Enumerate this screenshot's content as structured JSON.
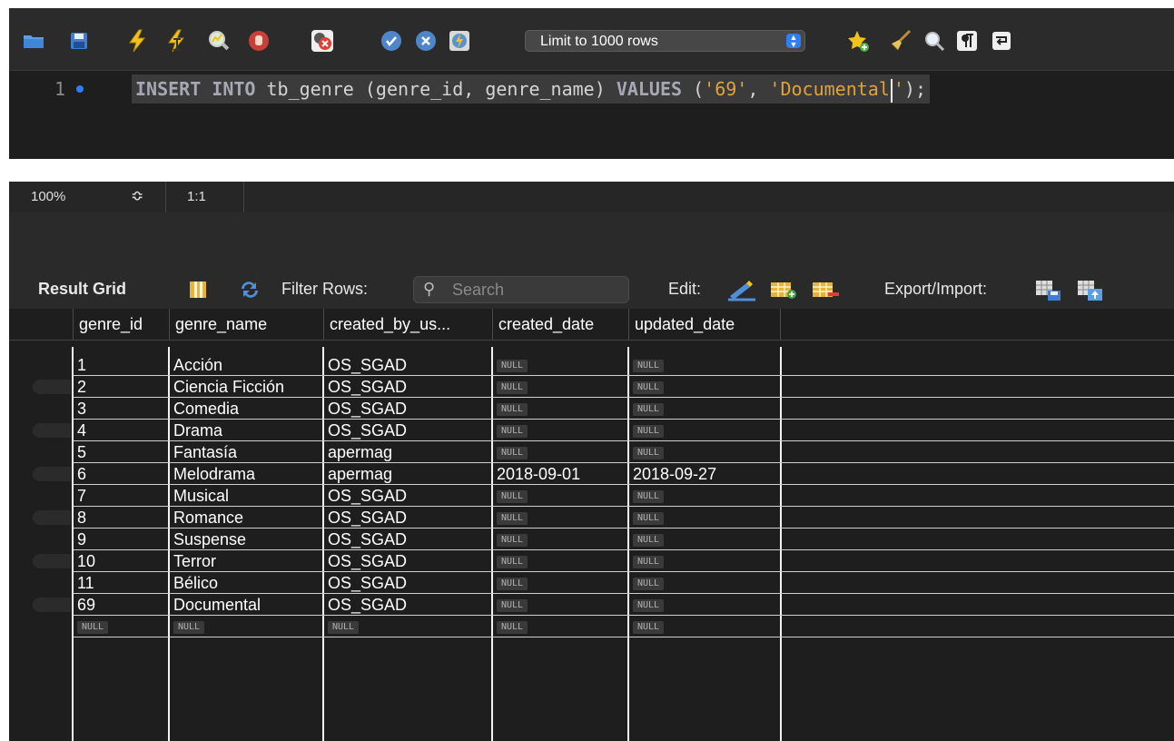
{
  "toolbar": {
    "limit_select_value": "Limit to 1000 rows",
    "icons": [
      "folder-icon",
      "save-icon",
      "execute-icon",
      "execute-current-icon",
      "explain-icon",
      "stop-icon",
      "toggle-error-icon",
      "commit-icon",
      "rollback-icon",
      "autocommit-icon",
      "bookmark-icon",
      "beautify-icon",
      "find-icon",
      "invisible-chars-icon",
      "wrap-icon"
    ]
  },
  "editor": {
    "line_number": "1",
    "code": {
      "kw1": "INSERT INTO",
      "plain1": " tb_genre (genre_id, genre_name) ",
      "kw2": "VALUES",
      "plain2": " (",
      "str1": "'69'",
      "plain3": ", ",
      "str2a": "'Documental",
      "str2b": "'",
      "plain4": ");"
    }
  },
  "status_bar": {
    "zoom": "100%",
    "stepper": "≎",
    "position": "1:1"
  },
  "result_toolbar": {
    "result_grid_label": "Result Grid",
    "filter_rows_label": "Filter Rows:",
    "search_placeholder": "Search",
    "edit_label": "Edit:",
    "export_import_label": "Export/Import:"
  },
  "grid": {
    "columns": [
      "genre_id",
      "genre_name",
      "created_by_us...",
      "created_date",
      "updated_date"
    ],
    "null_label": "NULL",
    "rows": [
      [
        "1",
        "Acción",
        "OS_SGAD",
        null,
        null
      ],
      [
        "2",
        "Ciencia Ficción",
        "OS_SGAD",
        null,
        null
      ],
      [
        "3",
        "Comedia",
        "OS_SGAD",
        null,
        null
      ],
      [
        "4",
        "Drama",
        "OS_SGAD",
        null,
        null
      ],
      [
        "5",
        "Fantasía",
        "apermag",
        null,
        null
      ],
      [
        "6",
        "Melodrama",
        "apermag",
        "2018-09-01",
        "2018-09-27"
      ],
      [
        "7",
        "Musical",
        "OS_SGAD",
        null,
        null
      ],
      [
        "8",
        "Romance",
        "OS_SGAD",
        null,
        null
      ],
      [
        "9",
        "Suspense",
        "OS_SGAD",
        null,
        null
      ],
      [
        "10",
        "Terror",
        "OS_SGAD",
        null,
        null
      ],
      [
        "11",
        "Bélico",
        "OS_SGAD",
        null,
        null
      ],
      [
        "69",
        "Documental",
        "OS_SGAD",
        null,
        null
      ],
      [
        null,
        null,
        null,
        null,
        null
      ]
    ]
  },
  "colors": {
    "editor_bg": "#1e1e1e",
    "toolbar_bg": "#2b2b2b",
    "keyword": "#a7a7b5",
    "string": "#e0a23a",
    "accent_blue": "#2f7ff2"
  }
}
